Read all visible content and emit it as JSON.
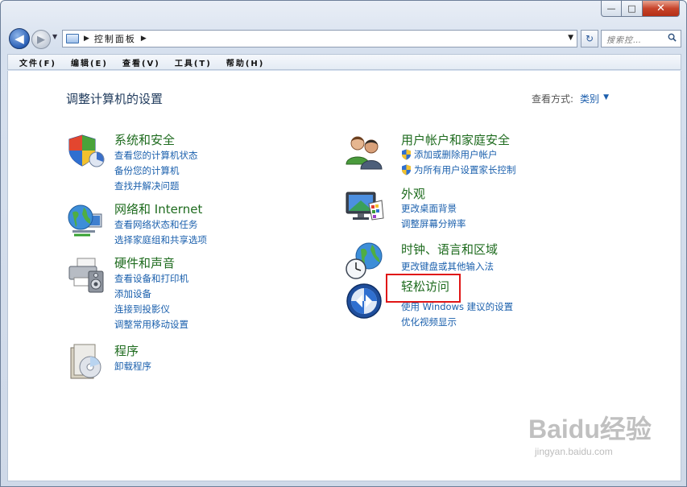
{
  "window": {
    "buttons": {
      "minimize": "—",
      "maximize": "□",
      "close": "✕"
    }
  },
  "address": {
    "path_label": "控制面板",
    "search_placeholder": "搜索控…"
  },
  "menu": [
    "文件(F)",
    "编辑(E)",
    "查看(V)",
    "工具(T)",
    "帮助(H)"
  ],
  "main": {
    "title": "调整计算机的设置",
    "view_by_label": "查看方式:",
    "view_by_value": "类别"
  },
  "categories": [
    {
      "title": "系统和安全",
      "icon": "shield-security-icon",
      "links": [
        "查看您的计算机状态",
        "备份您的计算机",
        "查找并解决问题"
      ]
    },
    {
      "title": "网络和 Internet",
      "icon": "globe-network-icon",
      "links": [
        "查看网络状态和任务",
        "选择家庭组和共享选项"
      ]
    },
    {
      "title": "硬件和声音",
      "icon": "printer-speaker-icon",
      "links": [
        "查看设备和打印机",
        "添加设备",
        "连接到投影仪",
        "调整常用移动设置"
      ]
    },
    {
      "title": "程序",
      "icon": "programs-disc-icon",
      "links": [
        "卸载程序"
      ]
    },
    {
      "title": "用户帐户和家庭安全",
      "icon": "users-icon",
      "links": [
        "添加或删除用户帐户",
        "为所有用户设置家长控制"
      ]
    },
    {
      "title": "外观",
      "icon": "monitor-palette-icon",
      "links": [
        "更改桌面背景",
        "调整屏幕分辨率"
      ]
    },
    {
      "title": "时钟、语言和区域",
      "icon": "clock-globe-icon",
      "links": [
        "更改键盘或其他输入法"
      ]
    },
    {
      "title": "轻松访问",
      "icon": "ease-of-access-icon",
      "links": [
        "使用 Windows 建议的设置",
        "优化视频显示"
      ]
    }
  ],
  "watermark": {
    "logo": "Baidu经验",
    "url": "jingyan.baidu.com"
  },
  "colors": {
    "category_title": "#1e6b1e",
    "link": "#1b60ad",
    "highlight_box": "#e01616"
  }
}
